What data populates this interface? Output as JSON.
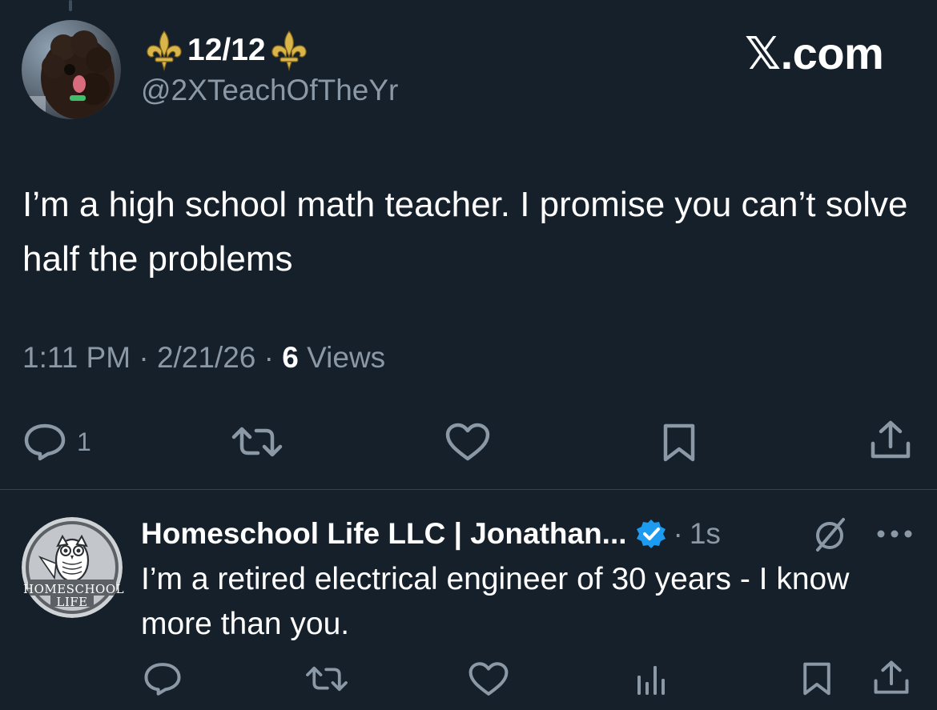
{
  "tweet": {
    "display_name": "12/12",
    "handle": "@2XTeachOfTheYr",
    "brand": "𝕏.com",
    "text": "I’m a high school math teacher. I promise you can’t solve half the problems",
    "time": "1:11 PM",
    "date": "2/21/26",
    "views_count": "6",
    "views_label": "Views",
    "separator": "·",
    "actions": {
      "reply_count": "1",
      "reply_icon": "reply-icon",
      "repost_icon": "repost-icon",
      "like_icon": "heart-icon",
      "bookmark_icon": "bookmark-icon",
      "share_icon": "share-icon"
    }
  },
  "reply": {
    "display_name": "Homeschool Life LLC | Jonathan...",
    "verified": true,
    "time_separator": "·",
    "time": "1s",
    "text": "I’m a retired electrical engineer of 30 years - I know more than you.",
    "avatar_logo_text": "HOMESCHOOL LIFE",
    "actions": {
      "reply_icon": "reply-icon",
      "repost_icon": "repost-icon",
      "like_icon": "heart-icon",
      "analytics_icon": "analytics-icon",
      "bookmark_icon": "bookmark-icon",
      "share_icon": "share-icon"
    }
  },
  "colors": {
    "background": "#15202b",
    "text_primary": "#ffffff",
    "text_secondary": "#8b98a5",
    "verified_blue": "#1d9bf0",
    "fleur_gold": "#d9b54a",
    "divider": "#38444d"
  }
}
